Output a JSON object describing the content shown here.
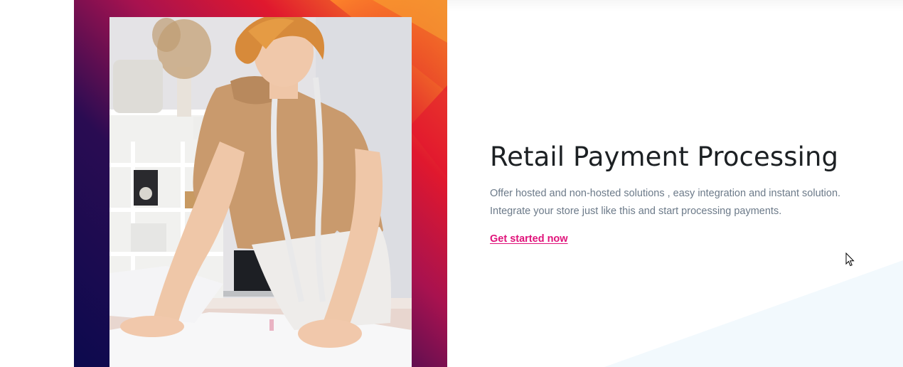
{
  "hero": {
    "title": "Retail Payment Processing",
    "description_line1": "Offer hosted and non-hosted solutions , easy integration and instant solution.",
    "description_line2": "Integrate your store just like this and start processing payments.",
    "cta_label": "Get started now"
  },
  "colors": {
    "accent": "#e0137a",
    "title": "#1c2023",
    "body_text": "#6c7a89",
    "frame_gradient": [
      "#0c0a4e",
      "#a8124f",
      "#e0182e",
      "#f47a26",
      "#f2ab32"
    ],
    "background_shape": "#f2f9fd"
  },
  "media": {
    "photo_subject": "person-measuring-fabric-photo"
  },
  "icons": {
    "pointer": "mouse-cursor-icon"
  }
}
